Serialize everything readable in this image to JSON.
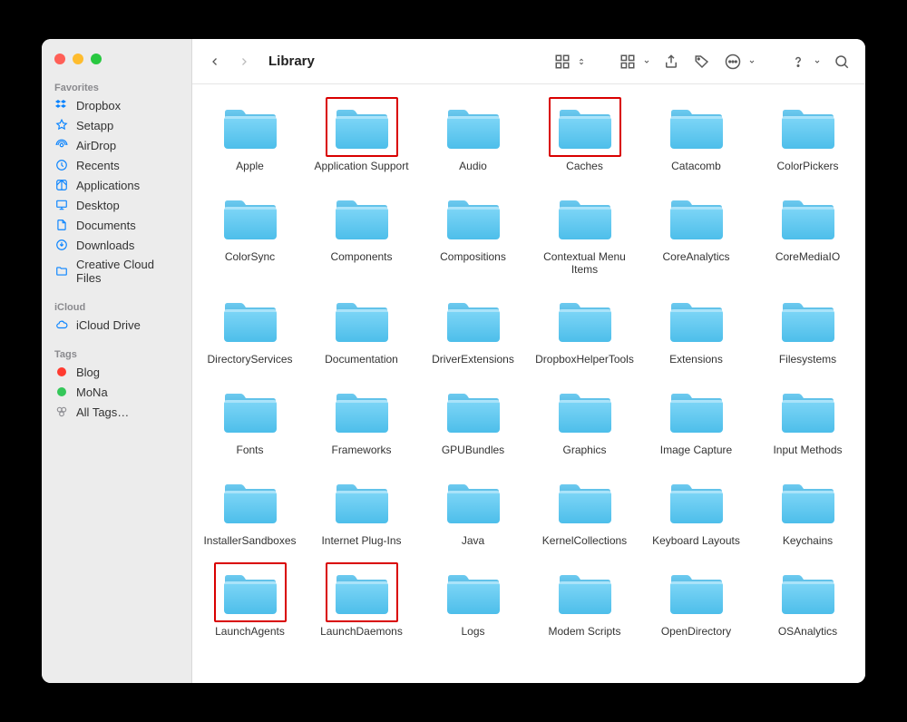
{
  "window": {
    "title": "Library"
  },
  "sidebar": {
    "sections": {
      "favorites": {
        "label": "Favorites",
        "items": [
          {
            "name": "Dropbox",
            "icon": "dropbox-icon"
          },
          {
            "name": "Setapp",
            "icon": "setapp-icon"
          },
          {
            "name": "AirDrop",
            "icon": "airdrop-icon"
          },
          {
            "name": "Recents",
            "icon": "recents-icon"
          },
          {
            "name": "Applications",
            "icon": "applications-icon"
          },
          {
            "name": "Desktop",
            "icon": "desktop-icon"
          },
          {
            "name": "Documents",
            "icon": "documents-icon"
          },
          {
            "name": "Downloads",
            "icon": "downloads-icon"
          },
          {
            "name": "Creative Cloud Files",
            "icon": "folder-icon"
          }
        ]
      },
      "icloud": {
        "label": "iCloud",
        "items": [
          {
            "name": "iCloud Drive",
            "icon": "icloud-icon"
          }
        ]
      },
      "tags": {
        "label": "Tags",
        "items": [
          {
            "name": "Blog",
            "color": "red"
          },
          {
            "name": "MoNa",
            "color": "green"
          },
          {
            "name": "All Tags…",
            "icon": "alltags-icon"
          }
        ]
      }
    }
  },
  "folders": [
    {
      "name": "Apple",
      "highlight": false
    },
    {
      "name": "Application Support",
      "highlight": true
    },
    {
      "name": "Audio",
      "highlight": false
    },
    {
      "name": "Caches",
      "highlight": true
    },
    {
      "name": "Catacomb",
      "highlight": false
    },
    {
      "name": "ColorPickers",
      "highlight": false
    },
    {
      "name": "ColorSync",
      "highlight": false
    },
    {
      "name": "Components",
      "highlight": false
    },
    {
      "name": "Compositions",
      "highlight": false
    },
    {
      "name": "Contextual Menu Items",
      "highlight": false
    },
    {
      "name": "CoreAnalytics",
      "highlight": false
    },
    {
      "name": "CoreMediaIO",
      "highlight": false
    },
    {
      "name": "DirectoryServices",
      "highlight": false
    },
    {
      "name": "Documentation",
      "highlight": false
    },
    {
      "name": "DriverExtensions",
      "highlight": false
    },
    {
      "name": "DropboxHelperTools",
      "highlight": false
    },
    {
      "name": "Extensions",
      "highlight": false
    },
    {
      "name": "Filesystems",
      "highlight": false
    },
    {
      "name": "Fonts",
      "highlight": false
    },
    {
      "name": "Frameworks",
      "highlight": false
    },
    {
      "name": "GPUBundles",
      "highlight": false
    },
    {
      "name": "Graphics",
      "highlight": false
    },
    {
      "name": "Image Capture",
      "highlight": false
    },
    {
      "name": "Input Methods",
      "highlight": false
    },
    {
      "name": "InstallerSandboxes",
      "highlight": false
    },
    {
      "name": "Internet Plug-Ins",
      "highlight": false
    },
    {
      "name": "Java",
      "highlight": false
    },
    {
      "name": "KernelCollections",
      "highlight": false
    },
    {
      "name": "Keyboard Layouts",
      "highlight": false
    },
    {
      "name": "Keychains",
      "highlight": false
    },
    {
      "name": "LaunchAgents",
      "highlight": true
    },
    {
      "name": "LaunchDaemons",
      "highlight": true
    },
    {
      "name": "Logs",
      "highlight": false
    },
    {
      "name": "Modem Scripts",
      "highlight": false
    },
    {
      "name": "OpenDirectory",
      "highlight": false
    },
    {
      "name": "OSAnalytics",
      "highlight": false
    }
  ]
}
